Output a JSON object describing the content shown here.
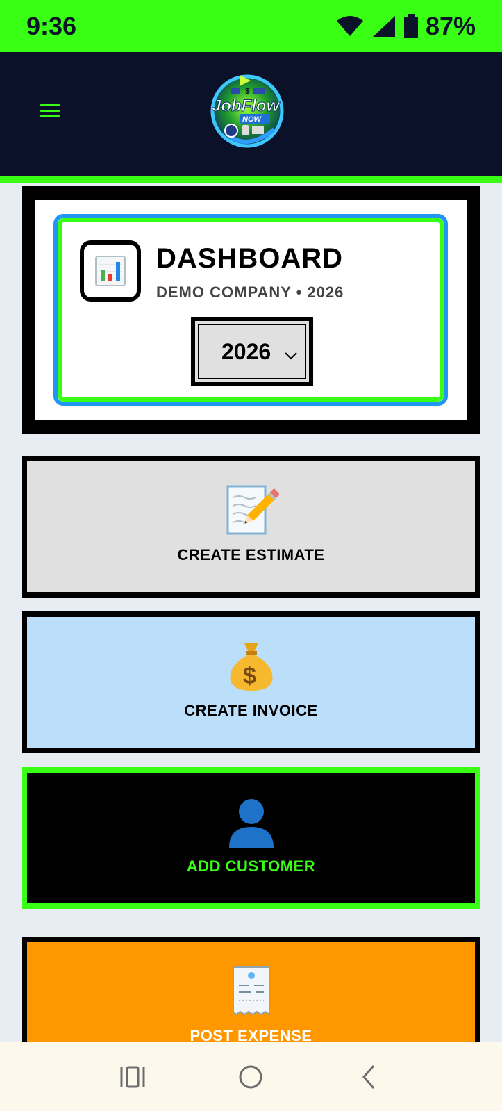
{
  "status_bar": {
    "time": "9:36",
    "battery": "87%",
    "icons": [
      "wifi-icon",
      "signal-icon",
      "battery-icon"
    ]
  },
  "app_bar": {
    "menu_icon": "hamburger-menu-icon",
    "logo_text": "JobFlow NOW",
    "accent_color": "#39ff14",
    "background_color": "#0b1128"
  },
  "dashboard": {
    "title": "DASHBOARD",
    "subtitle": "DEMO COMPANY • 2026",
    "icon": "bar-chart-icon",
    "year_select": {
      "selected": "2026"
    }
  },
  "actions": [
    {
      "label": "CREATE ESTIMATE",
      "icon": "memo-pencil-icon",
      "bg": "#e0e0e0",
      "border": "#000000",
      "text_color": "#000000"
    },
    {
      "label": "CREATE INVOICE",
      "icon": "money-bag-icon",
      "bg": "#bbdefb",
      "border": "#000000",
      "text_color": "#000000"
    },
    {
      "label": "ADD CUSTOMER",
      "icon": "user-silhouette-icon",
      "bg": "#000000",
      "border": "#39ff14",
      "text_color": "#39ff14"
    },
    {
      "label": "POST EXPENSE",
      "icon": "receipt-icon",
      "bg": "#ff9800",
      "border": "#000000",
      "text_color": "#ffffff"
    }
  ],
  "nav_bar": {
    "buttons": [
      "recent-apps-icon",
      "home-icon",
      "back-icon"
    ]
  }
}
